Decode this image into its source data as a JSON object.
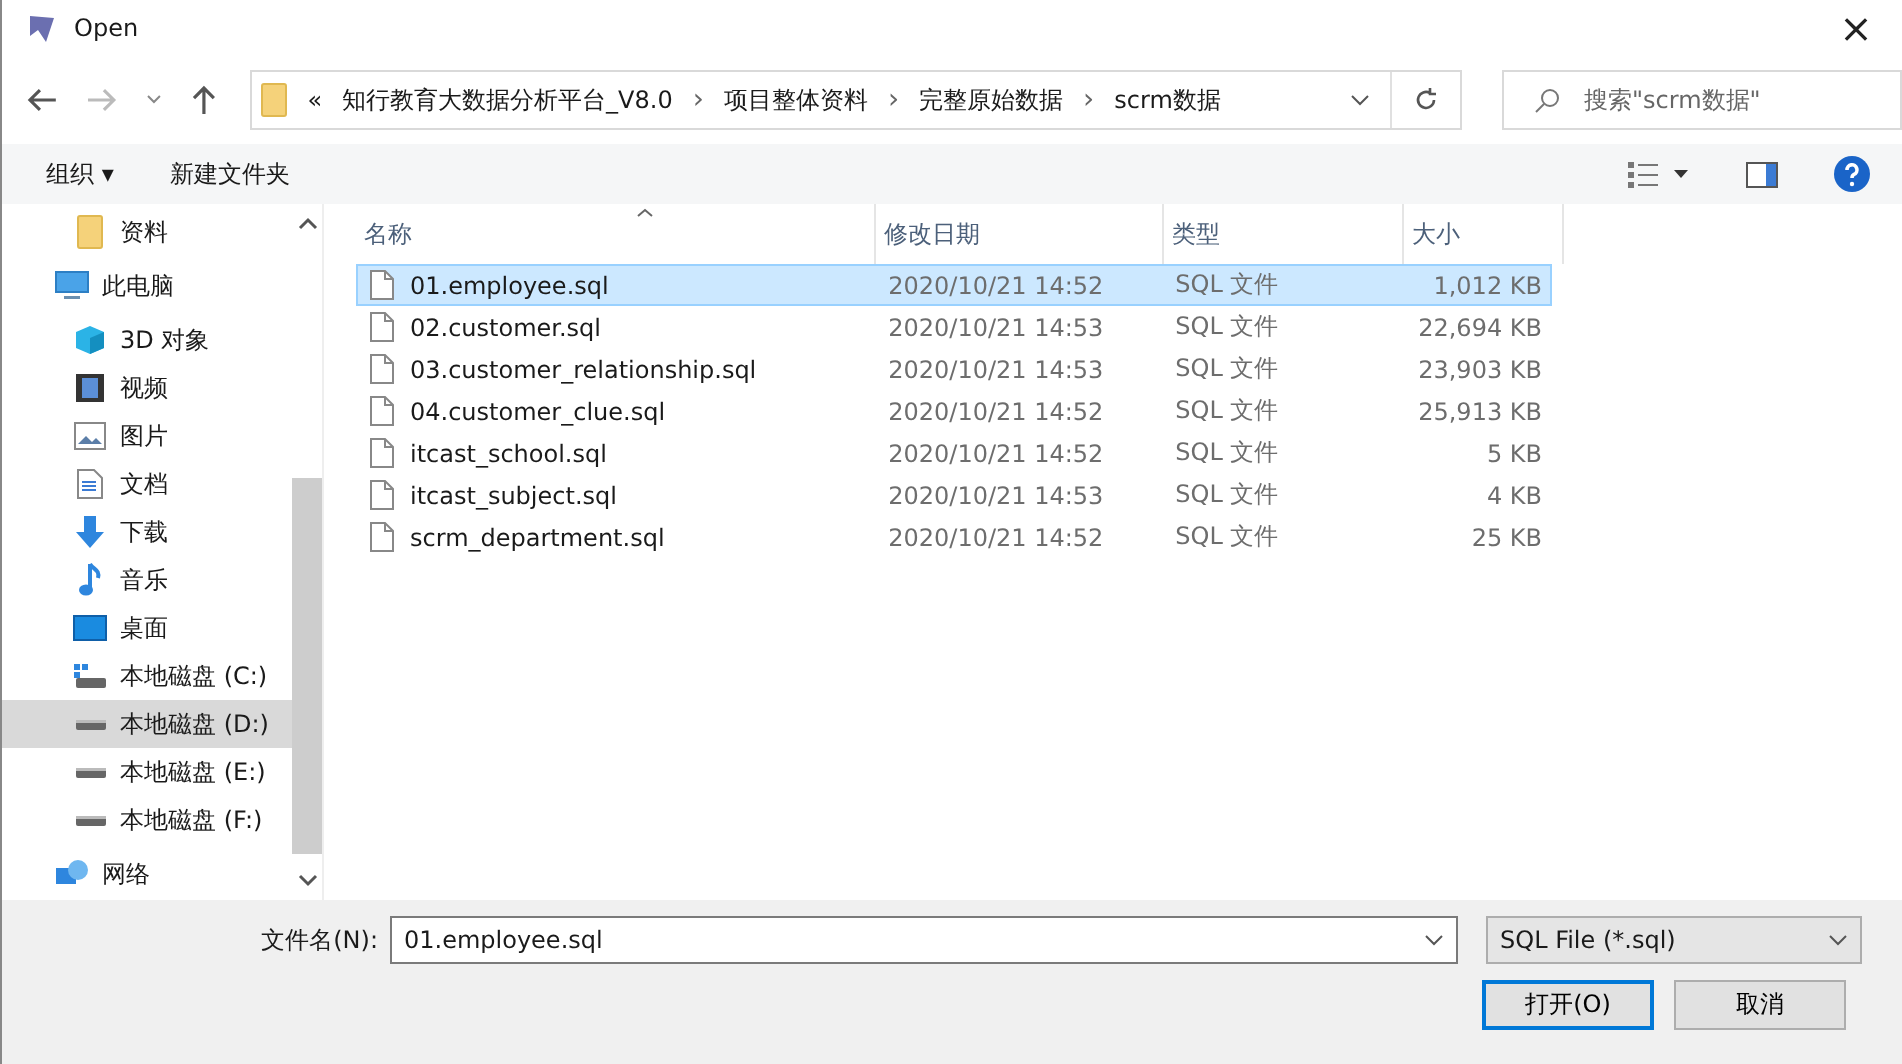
{
  "window": {
    "title": "Open",
    "close": "×"
  },
  "address": {
    "overflow": "«",
    "crumbs": [
      "知行教育大数据分析平台_V8.0",
      "项目整体资料",
      "完整原始数据",
      "scrm数据"
    ],
    "separator": "›"
  },
  "search": {
    "placeholder": "搜索\"scrm数据\""
  },
  "toolbar": {
    "organize": "组织 ▾",
    "new_folder": "新建文件夹"
  },
  "sidebar": {
    "quick_access_items": [
      {
        "label": "资料",
        "kind": "folder",
        "selected": false
      }
    ],
    "items": [
      {
        "label": "此电脑",
        "kind": "pc",
        "selected": false,
        "children": [
          {
            "label": "3D 对象",
            "kind": "cube",
            "selected": false
          },
          {
            "label": "视频",
            "kind": "video",
            "selected": false
          },
          {
            "label": "图片",
            "kind": "picture",
            "selected": false
          },
          {
            "label": "文档",
            "kind": "doc",
            "selected": false
          },
          {
            "label": "下载",
            "kind": "download",
            "selected": false
          },
          {
            "label": "音乐",
            "kind": "music",
            "selected": false
          },
          {
            "label": "桌面",
            "kind": "desktop",
            "selected": false
          },
          {
            "label": "本地磁盘 (C:)",
            "kind": "sysdrive",
            "selected": false
          },
          {
            "label": "本地磁盘 (D:)",
            "kind": "drive",
            "selected": true
          },
          {
            "label": "本地磁盘 (E:)",
            "kind": "drive",
            "selected": false
          },
          {
            "label": "本地磁盘 (F:)",
            "kind": "drive",
            "selected": false
          }
        ]
      },
      {
        "label": "网络",
        "kind": "network",
        "selected": false
      }
    ]
  },
  "table": {
    "columns": [
      "名称",
      "修改日期",
      "类型",
      "大小"
    ],
    "rows": [
      {
        "name": "01.employee.sql",
        "date": "2020/10/21 14:52",
        "type": "SQL 文件",
        "size": "1,012 KB",
        "selected": true
      },
      {
        "name": "02.customer.sql",
        "date": "2020/10/21 14:53",
        "type": "SQL 文件",
        "size": "22,694 KB",
        "selected": false
      },
      {
        "name": "03.customer_relationship.sql",
        "date": "2020/10/21 14:53",
        "type": "SQL 文件",
        "size": "23,903 KB",
        "selected": false
      },
      {
        "name": "04.customer_clue.sql",
        "date": "2020/10/21 14:52",
        "type": "SQL 文件",
        "size": "25,913 KB",
        "selected": false
      },
      {
        "name": "itcast_school.sql",
        "date": "2020/10/21 14:52",
        "type": "SQL 文件",
        "size": "5 KB",
        "selected": false
      },
      {
        "name": "itcast_subject.sql",
        "date": "2020/10/21 14:53",
        "type": "SQL 文件",
        "size": "4 KB",
        "selected": false
      },
      {
        "name": "scrm_department.sql",
        "date": "2020/10/21 14:52",
        "type": "SQL 文件",
        "size": "25 KB",
        "selected": false
      }
    ]
  },
  "footer": {
    "filename_label": "文件名(N):",
    "filename": "01.employee.sql",
    "filter": "SQL File (*.sql)",
    "buttons": [
      "打开(O)",
      "取消"
    ]
  }
}
